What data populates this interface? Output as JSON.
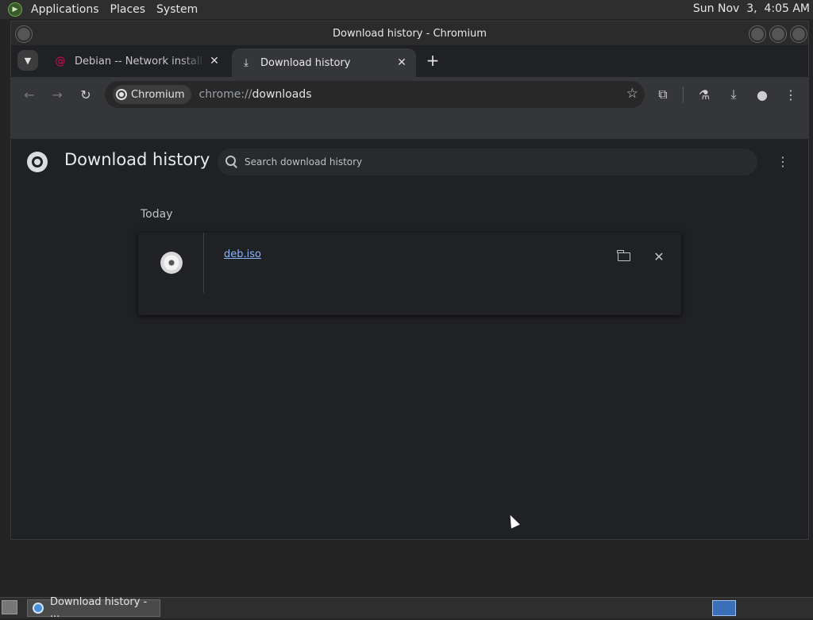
{
  "top_panel": {
    "menus": [
      "Applications",
      "Places",
      "System"
    ],
    "clock": "Sun Nov  3,  4:05 AM"
  },
  "window": {
    "title": "Download history - Chromium"
  },
  "tabs": [
    {
      "title": "Debian -- Network install from",
      "active": false,
      "favicon": "debian-swirl-icon"
    },
    {
      "title": "Download history",
      "active": true,
      "favicon": "download-icon"
    }
  ],
  "toolbar": {
    "site_chip": "Chromium",
    "url_scheme": "chrome://",
    "url_host": "downloads"
  },
  "downloads_page": {
    "title": "Download history",
    "search_placeholder": "Search download history",
    "date_group": "Today",
    "items": [
      {
        "file_name": "deb.iso",
        "icon": "disc-icon"
      }
    ]
  },
  "taskbar": {
    "task_label": "Download history - ..."
  },
  "colors": {
    "link": "#8ab4f8",
    "page_bg": "#202124",
    "toolbar_bg": "#35363a"
  }
}
